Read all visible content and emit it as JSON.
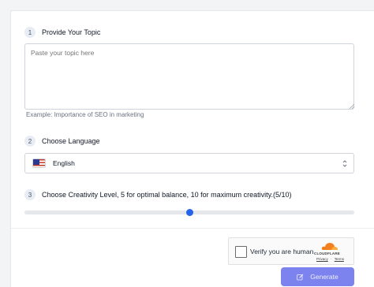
{
  "steps": [
    {
      "num": "1",
      "label": "Provide Your Topic"
    },
    {
      "num": "2",
      "label": "Choose Language"
    },
    {
      "num": "3",
      "label": "Choose Creativity Level, 5 for optimal balance, 10 for maximum creativity.(5/10)"
    }
  ],
  "topic": {
    "placeholder": "Paste your topic here",
    "value": "",
    "example": "Example:  Importance of SEO in marketing"
  },
  "language": {
    "selected": "English",
    "flag_icon": "us-flag-icon"
  },
  "creativity": {
    "value": 5,
    "min": 0,
    "max": 10
  },
  "captcha": {
    "label": "Verify you are human",
    "brand": "CLOUDFLARE",
    "privacy": "Privacy",
    "separator": "·",
    "terms": "Terms"
  },
  "generate": {
    "label": "Generate",
    "icon": "edit-icon"
  },
  "colors": {
    "accent": "#2563eb",
    "button": "#7c83ee",
    "cloudflare": "#f38020"
  }
}
